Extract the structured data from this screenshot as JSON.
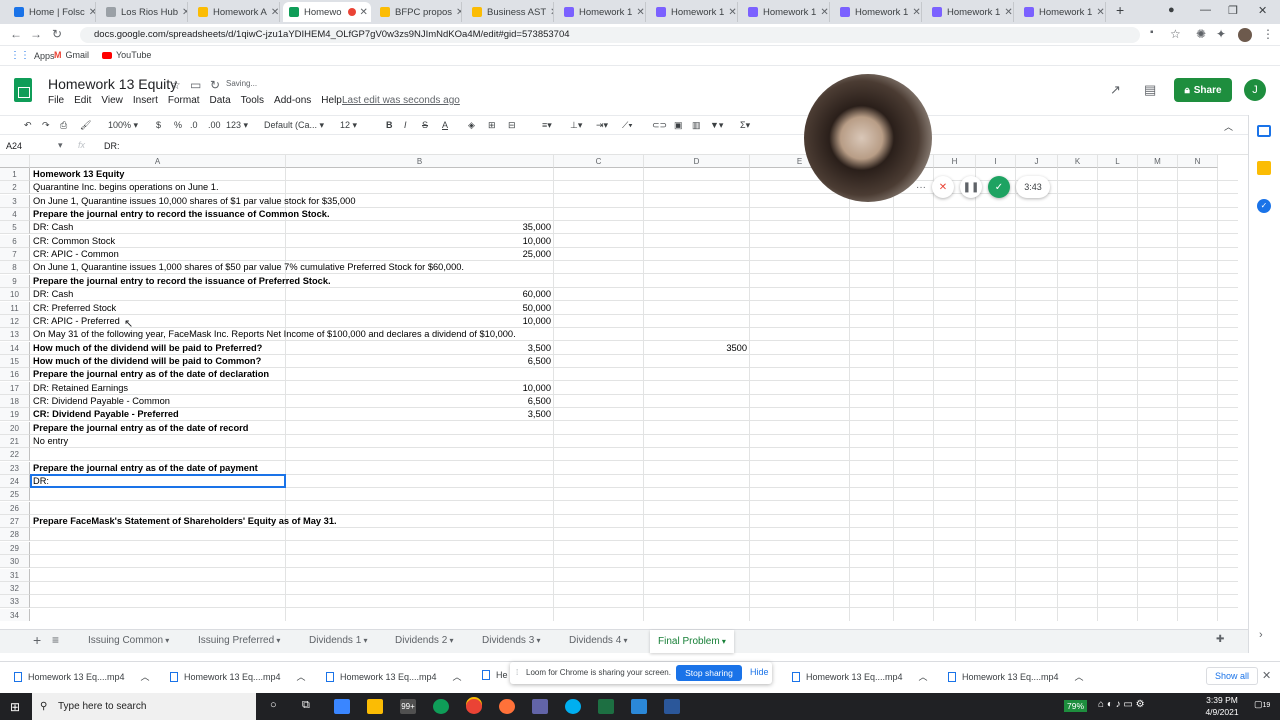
{
  "browser": {
    "tabs": [
      {
        "label": "Home | Folsc",
        "color": "#1a73e8"
      },
      {
        "label": "Los Rios Hub",
        "color": "#9aa0a6"
      },
      {
        "label": "Homework A",
        "color": "#fbbc04"
      },
      {
        "label": "Homewo",
        "color": "#0f9d58"
      },
      {
        "label": "BFPC propos",
        "color": "#fbbc04"
      },
      {
        "label": "Business AST",
        "color": "#fbbc04"
      },
      {
        "label": "Homework 1",
        "color": "#7b61ff"
      },
      {
        "label": "Homework 1",
        "color": "#7b61ff"
      },
      {
        "label": "Homework 1",
        "color": "#7b61ff"
      },
      {
        "label": "Homework 1",
        "color": "#7b61ff"
      },
      {
        "label": "Homework 1",
        "color": "#7b61ff"
      },
      {
        "label": "Homework 1",
        "color": "#7b61ff"
      }
    ],
    "url": "docs.google.com/spreadsheets/d/1qiwC-jzu1aYDIHEM4_OLfGP7gV0w3zs9NJImNdKOa4M/edit#gid=573853704",
    "bookmarks": [
      "Apps",
      "Gmail",
      "YouTube"
    ]
  },
  "doc": {
    "title": "Homework 13 Equity",
    "saving": "Saving...",
    "menu": [
      "File",
      "Edit",
      "View",
      "Insert",
      "Format",
      "Data",
      "Tools",
      "Add-ons",
      "Help"
    ],
    "last_edit": "Last edit was seconds ago",
    "share_label": "Share",
    "avatar_letter": "J"
  },
  "toolbar": {
    "zoom": "100%",
    "currency": "$",
    "percent": "%",
    "dec1": ".0",
    "dec2": ".00",
    "numfmt": "123",
    "font": "Default (Ca...",
    "size": "12"
  },
  "formula": {
    "cell_ref": "A24",
    "content": "DR:"
  },
  "grid": {
    "columns": [
      "A",
      "B",
      "C",
      "D",
      "E",
      "F",
      "G",
      "H",
      "I",
      "J",
      "K",
      "L",
      "M",
      "N"
    ],
    "rows": [
      {
        "n": "1",
        "a": "Homework 13 Equity",
        "bold": true,
        "b": "",
        "d": ""
      },
      {
        "n": "2",
        "a": "Quarantine Inc. begins operations on June 1.",
        "bold": false,
        "b": "",
        "d": ""
      },
      {
        "n": "3",
        "a": "On June 1, Quarantine issues 10,000 shares of $1 par value stock for $35,000",
        "bold": false,
        "b": "",
        "d": ""
      },
      {
        "n": "4",
        "a": "Prepare the journal entry to record the issuance of Common Stock.",
        "bold": true,
        "b": "",
        "d": ""
      },
      {
        "n": "5",
        "a": "DR:  Cash",
        "bold": false,
        "b": "35,000",
        "d": ""
      },
      {
        "n": "6",
        "a": "CR:  Common Stock",
        "bold": false,
        "b": "10,000",
        "d": ""
      },
      {
        "n": "7",
        "a": "CR:  APIC - Common",
        "bold": false,
        "b": "25,000",
        "d": ""
      },
      {
        "n": "8",
        "a": "On June 1, Quarantine issues 1,000 shares of $50 par value 7% cumulative Preferred Stock for $60,000.",
        "bold": false,
        "b": "",
        "d": ""
      },
      {
        "n": "9",
        "a": "Prepare the journal entry to record the issuance of Preferred Stock.",
        "bold": true,
        "b": "",
        "d": ""
      },
      {
        "n": "10",
        "a": "DR:  Cash",
        "bold": false,
        "b": "60,000",
        "d": ""
      },
      {
        "n": "11",
        "a": "CR:  Preferred Stock",
        "bold": false,
        "b": "50,000",
        "d": ""
      },
      {
        "n": "12",
        "a": "CR:  APIC - Preferred",
        "bold": false,
        "b": "10,000",
        "d": ""
      },
      {
        "n": "13",
        "a": "On May 31 of the following year, FaceMask Inc.  Reports Net Income of $100,000 and declares a dividend of $10,000.",
        "bold": false,
        "b": "",
        "d": ""
      },
      {
        "n": "14",
        "a": "How much of the dividend will be paid to Preferred?",
        "bold": true,
        "b": "3,500",
        "d": "3500"
      },
      {
        "n": "15",
        "a": "How much of the dividend will be paid to Common?",
        "bold": true,
        "b": "6,500",
        "d": ""
      },
      {
        "n": "16",
        "a": "Prepare the journal entry as of the date of declaration",
        "bold": true,
        "b": "",
        "d": ""
      },
      {
        "n": "17",
        "a": "DR: Retained Earnings",
        "bold": false,
        "b": "10,000",
        "d": ""
      },
      {
        "n": "18",
        "a": "CR:  Dividend Payable - Common",
        "bold": false,
        "b": "6,500",
        "d": ""
      },
      {
        "n": "19",
        "a": "CR:  Dividend Payable - Preferred",
        "bold": true,
        "b": "3,500",
        "d": ""
      },
      {
        "n": "20",
        "a": "Prepare the journal entry as of the date of record",
        "bold": true,
        "b": "",
        "d": ""
      },
      {
        "n": "21",
        "a": "No entry",
        "bold": false,
        "b": "",
        "d": ""
      },
      {
        "n": "22",
        "a": "",
        "bold": false,
        "b": "",
        "d": ""
      },
      {
        "n": "23",
        "a": "Prepare the journal entry as of the date of payment",
        "bold": true,
        "b": "",
        "d": ""
      },
      {
        "n": "24",
        "a": "DR:",
        "bold": false,
        "b": "",
        "d": ""
      },
      {
        "n": "25",
        "a": "",
        "bold": false,
        "b": "",
        "d": ""
      },
      {
        "n": "26",
        "a": "",
        "bold": false,
        "b": "",
        "d": ""
      },
      {
        "n": "27",
        "a": "Prepare FaceMask's Statement of Shareholders' Equity as of May 31.",
        "bold": true,
        "b": "",
        "d": ""
      },
      {
        "n": "28",
        "a": "",
        "bold": false,
        "b": "",
        "d": ""
      },
      {
        "n": "29",
        "a": "",
        "bold": false,
        "b": "",
        "d": ""
      },
      {
        "n": "30",
        "a": "",
        "bold": false,
        "b": "",
        "d": ""
      },
      {
        "n": "31",
        "a": "",
        "bold": false,
        "b": "",
        "d": ""
      },
      {
        "n": "32",
        "a": "",
        "bold": false,
        "b": "",
        "d": ""
      },
      {
        "n": "33",
        "a": "",
        "bold": false,
        "b": "",
        "d": ""
      },
      {
        "n": "34",
        "a": "",
        "bold": false,
        "b": "",
        "d": ""
      }
    ]
  },
  "sheet_tabs": {
    "tabs": [
      "Issuing Common",
      "Issuing Preferred",
      "Dividends 1",
      "Dividends 2",
      "Dividends 3",
      "Dividends 4",
      "Final Problem"
    ],
    "active": "Final Problem"
  },
  "recorder": {
    "timer": "3:43"
  },
  "downloads": {
    "items": [
      "Homework 13 Eq....mp4",
      "Homework 13 Eq....mp4",
      "Homework 13 Eq....mp4",
      "He",
      "Homework 13 Eq....mp4",
      "Homework 13 Eq....mp4"
    ],
    "show_all": "Show all"
  },
  "loom": {
    "message": "Loom for Chrome is sharing your screen.",
    "stop": "Stop sharing",
    "hide": "Hide"
  },
  "taskbar": {
    "search_placeholder": "Type here to search",
    "battery": "79%",
    "time": "3:39 PM",
    "date": "4/9/2021",
    "notifications": "19",
    "badge": "99+"
  }
}
